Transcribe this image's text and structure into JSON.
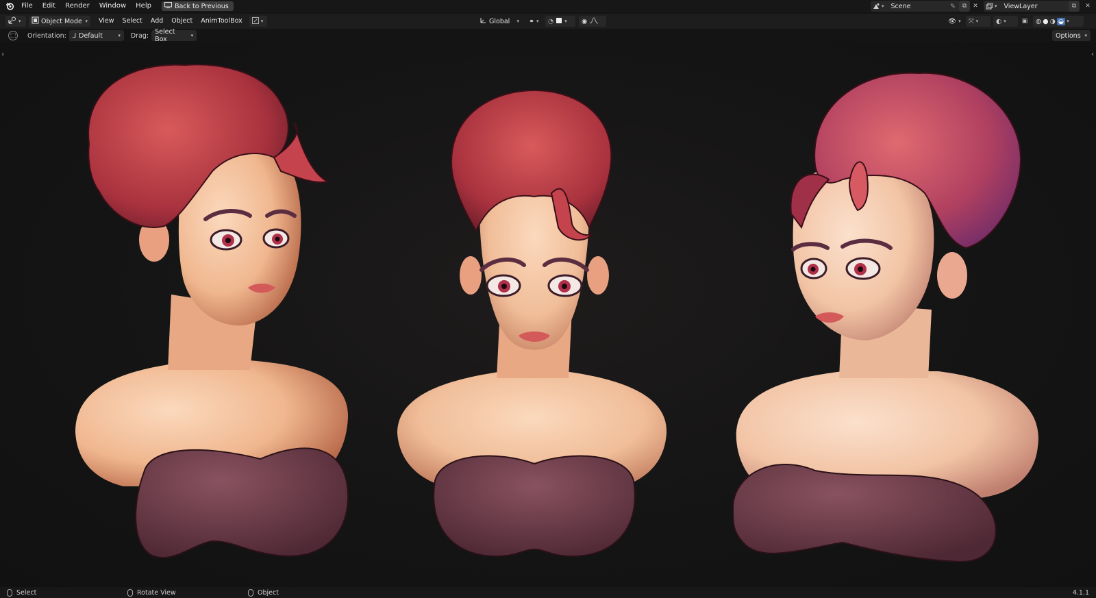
{
  "app": {
    "menu": [
      "File",
      "Edit",
      "Render",
      "Window",
      "Help"
    ],
    "back_button": "Back to Previous",
    "scene": "Scene",
    "view_layer": "ViewLayer"
  },
  "header": {
    "mode": "Object Mode",
    "menus": [
      "View",
      "Select",
      "Add",
      "Object",
      "AnimToolBox"
    ],
    "transform_orientation": "Global"
  },
  "tool_settings": {
    "orientation_label": "Orientation:",
    "orientation_value": "Default",
    "drag_label": "Drag:",
    "drag_value": "Select Box",
    "options_label": "Options"
  },
  "status": {
    "select": "Select",
    "rotate_view": "Rotate View",
    "object": "Object",
    "version": "4.1.1"
  },
  "colors": {
    "hair": "#c4434d",
    "skin": "#f2c3a6",
    "top": "#6e3c4a",
    "background": "#141414"
  }
}
